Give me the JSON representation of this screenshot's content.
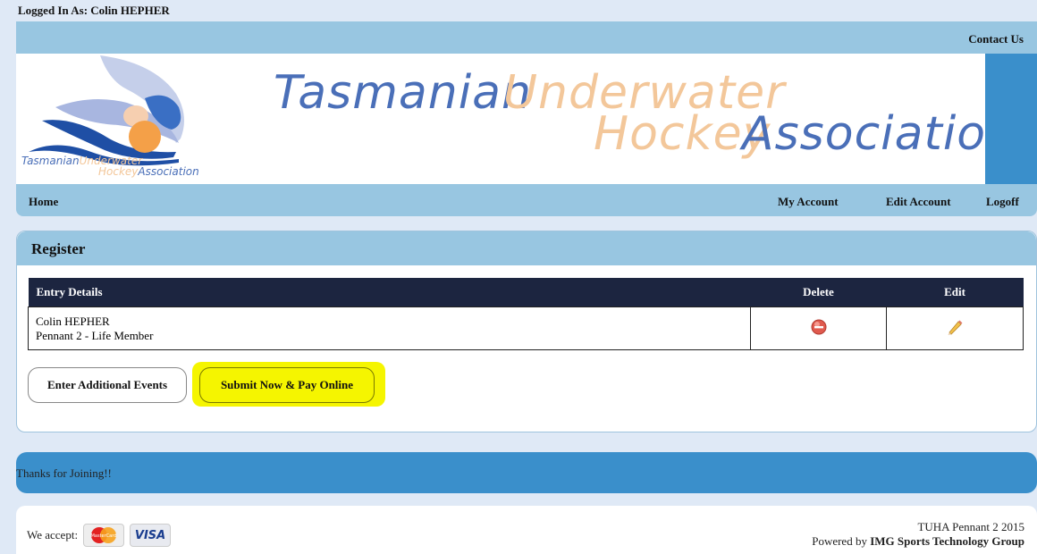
{
  "header": {
    "logged_in": "Logged In As: Colin HEPHER",
    "contact": "Contact Us"
  },
  "banner": {
    "logo_line1a": "Tasmanian",
    "logo_line1b": "Underwater",
    "logo_line2a": "Hockey",
    "logo_line2b": "Association",
    "title_word1": "Tasmanian",
    "title_word2": "Underwater",
    "title_word3": "Hockey",
    "title_word4": "Association"
  },
  "nav": {
    "home": "Home",
    "my_account": "My Account",
    "edit_account": "Edit Account",
    "logoff": "Logoff"
  },
  "register": {
    "title": "Register",
    "columns": [
      "Entry Details",
      "Delete",
      "Edit"
    ],
    "rows": [
      {
        "name": "Colin HEPHER",
        "detail": "Pennant 2 - Life Member"
      }
    ],
    "btn_additional": "Enter Additional Events",
    "btn_submit": "Submit Now & Pay Online"
  },
  "thanks": "Thanks for Joining!!",
  "footer": {
    "we_accept": "We accept:",
    "mastercard": "MasterCard",
    "visa": "VISA",
    "event": "TUHA Pennant 2 2015",
    "powered_prefix": "Powered by ",
    "powered_brand": "IMG Sports Technology Group"
  },
  "colors": {
    "light_blue": "#98c6e1",
    "mid_blue": "#3a8fcb",
    "table_header": "#1c2540",
    "highlight": "#f5f500",
    "title_blue": "#4a6fb8",
    "title_orange": "#f3c79a"
  }
}
